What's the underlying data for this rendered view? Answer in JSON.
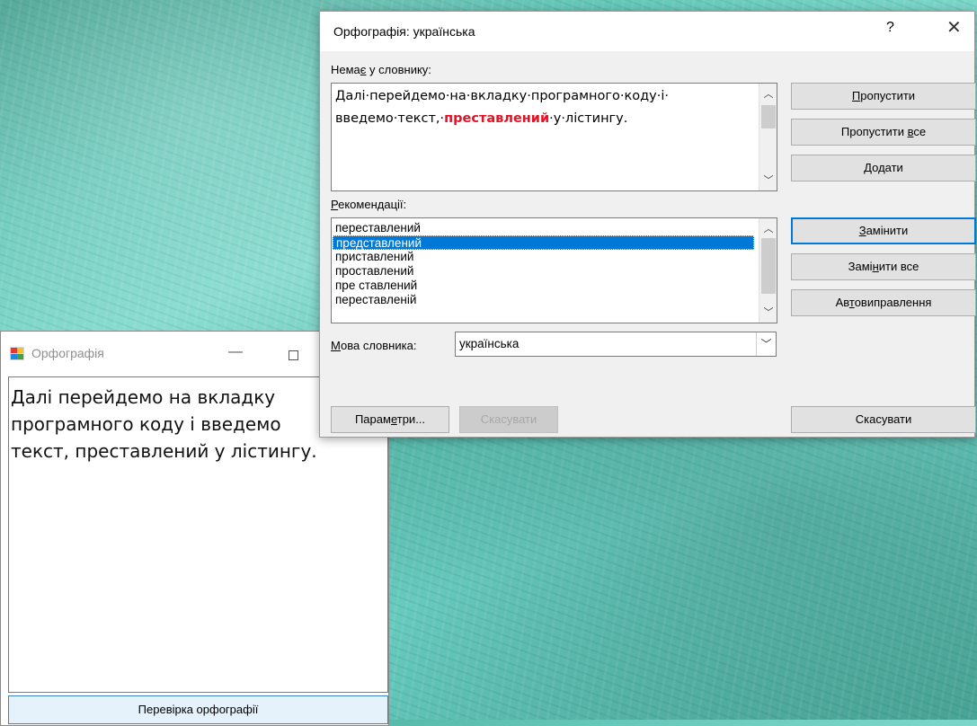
{
  "form_window": {
    "title": "Орфографія",
    "text_lines": [
      "Далі перейдемо на вкладку",
      "програмного коду і введемо",
      "текст, преставлений у лістингу."
    ],
    "check_button": "Перевірка орфографії"
  },
  "dialog": {
    "title": "Орфографія: українська",
    "help": "?",
    "close": "✕",
    "not_found_label": {
      "before": "Нема",
      "accel": "є",
      "after": " у словнику:"
    },
    "sentence": {
      "before": "Далі·перейдемо·на·вкладку·програмного·коду·і· введемо·текст,·",
      "error_word": "преставлений",
      "after": "·у·лістингу."
    },
    "suggestions_label": {
      "accel": "Р",
      "after": "екомендації:"
    },
    "suggestions": [
      "переставлений",
      "представлений",
      "приставлений",
      "проставлений",
      "пре ставлений",
      "переставленій"
    ],
    "selected_suggestion_index": 1,
    "language_label": {
      "accel": "М",
      "after": "ова словника:"
    },
    "language_value": "українська",
    "buttons": {
      "ignore": {
        "accel": "П",
        "after": "ропустити"
      },
      "ignore_all": {
        "before": "Пропустити ",
        "accel": "в",
        "after": "се"
      },
      "add": {
        "before": "До",
        "accel": "д",
        "after": "ати"
      },
      "change": {
        "before": "",
        "accel": "З",
        "after": "амінити"
      },
      "change_all": {
        "before": "Замі",
        "accel": "н",
        "after": "ити все"
      },
      "autocorrect": {
        "before": "Ав",
        "accel": "т",
        "after": "овиправлення"
      },
      "options": {
        "before": "Парам",
        "accel": "е",
        "after": "три..."
      },
      "undo": "Скасувати",
      "cancel": "Скасувати"
    }
  },
  "colors": {
    "error_word": "#e81123",
    "selection": "#0078d7",
    "default_button_border": "#0078d7"
  }
}
